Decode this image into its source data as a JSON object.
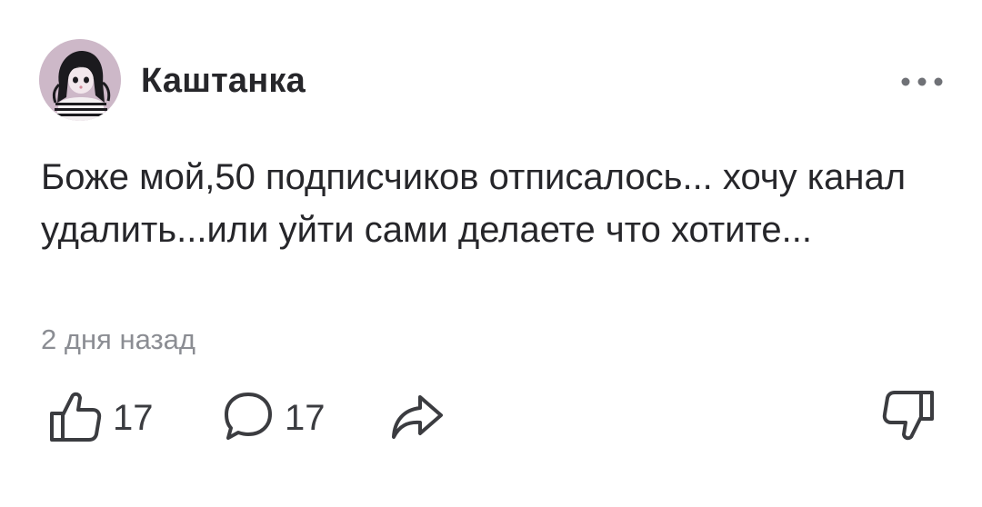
{
  "post": {
    "author": "Каштанка",
    "text": "Боже мой,50 подписчиков отписалось... хочу канал удалить...или уйти сами делаете что хотите...",
    "timestamp": "2 дня назад"
  },
  "actions": {
    "like_count": "17",
    "comment_count": "17"
  },
  "icons": {
    "avatar": "avatar",
    "more": "more-options-icon",
    "like": "thumbs-up-icon",
    "comment": "comment-bubble-icon",
    "share": "share-arrow-icon",
    "dislike": "thumbs-down-icon"
  },
  "colors": {
    "text": "#26262a",
    "muted": "#8b8d93",
    "icon": "#3b3c40",
    "avatar_bg": "#d5c3d0"
  }
}
